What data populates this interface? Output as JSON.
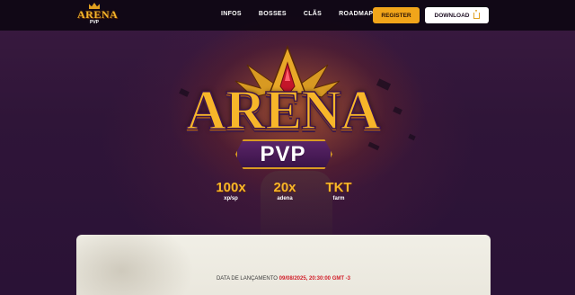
{
  "nav": {
    "logo_text": "ARENA",
    "logo_sub": "PVP",
    "links": [
      "INFOS",
      "BOSSES",
      "CLÃS",
      "ROADMAP"
    ],
    "register_label": "REGISTER",
    "download_label": "DOWNLOAD"
  },
  "hero": {
    "title": "ARENA",
    "subtitle": "PVP",
    "stats": [
      {
        "value": "100x",
        "label": "xp/sp"
      },
      {
        "value": "20x",
        "label": "adena"
      },
      {
        "value": "TKT",
        "label": "farm"
      }
    ]
  },
  "launch": {
    "label": "DATA DE LANÇAMENTO",
    "date": "09/08/2025, 20:30:00 GMT -3"
  },
  "colors": {
    "accent": "#f1a51a",
    "date_red": "#d21e2a",
    "background": "#2a1236"
  },
  "icons": [
    "crown-icon",
    "download-icon"
  ]
}
